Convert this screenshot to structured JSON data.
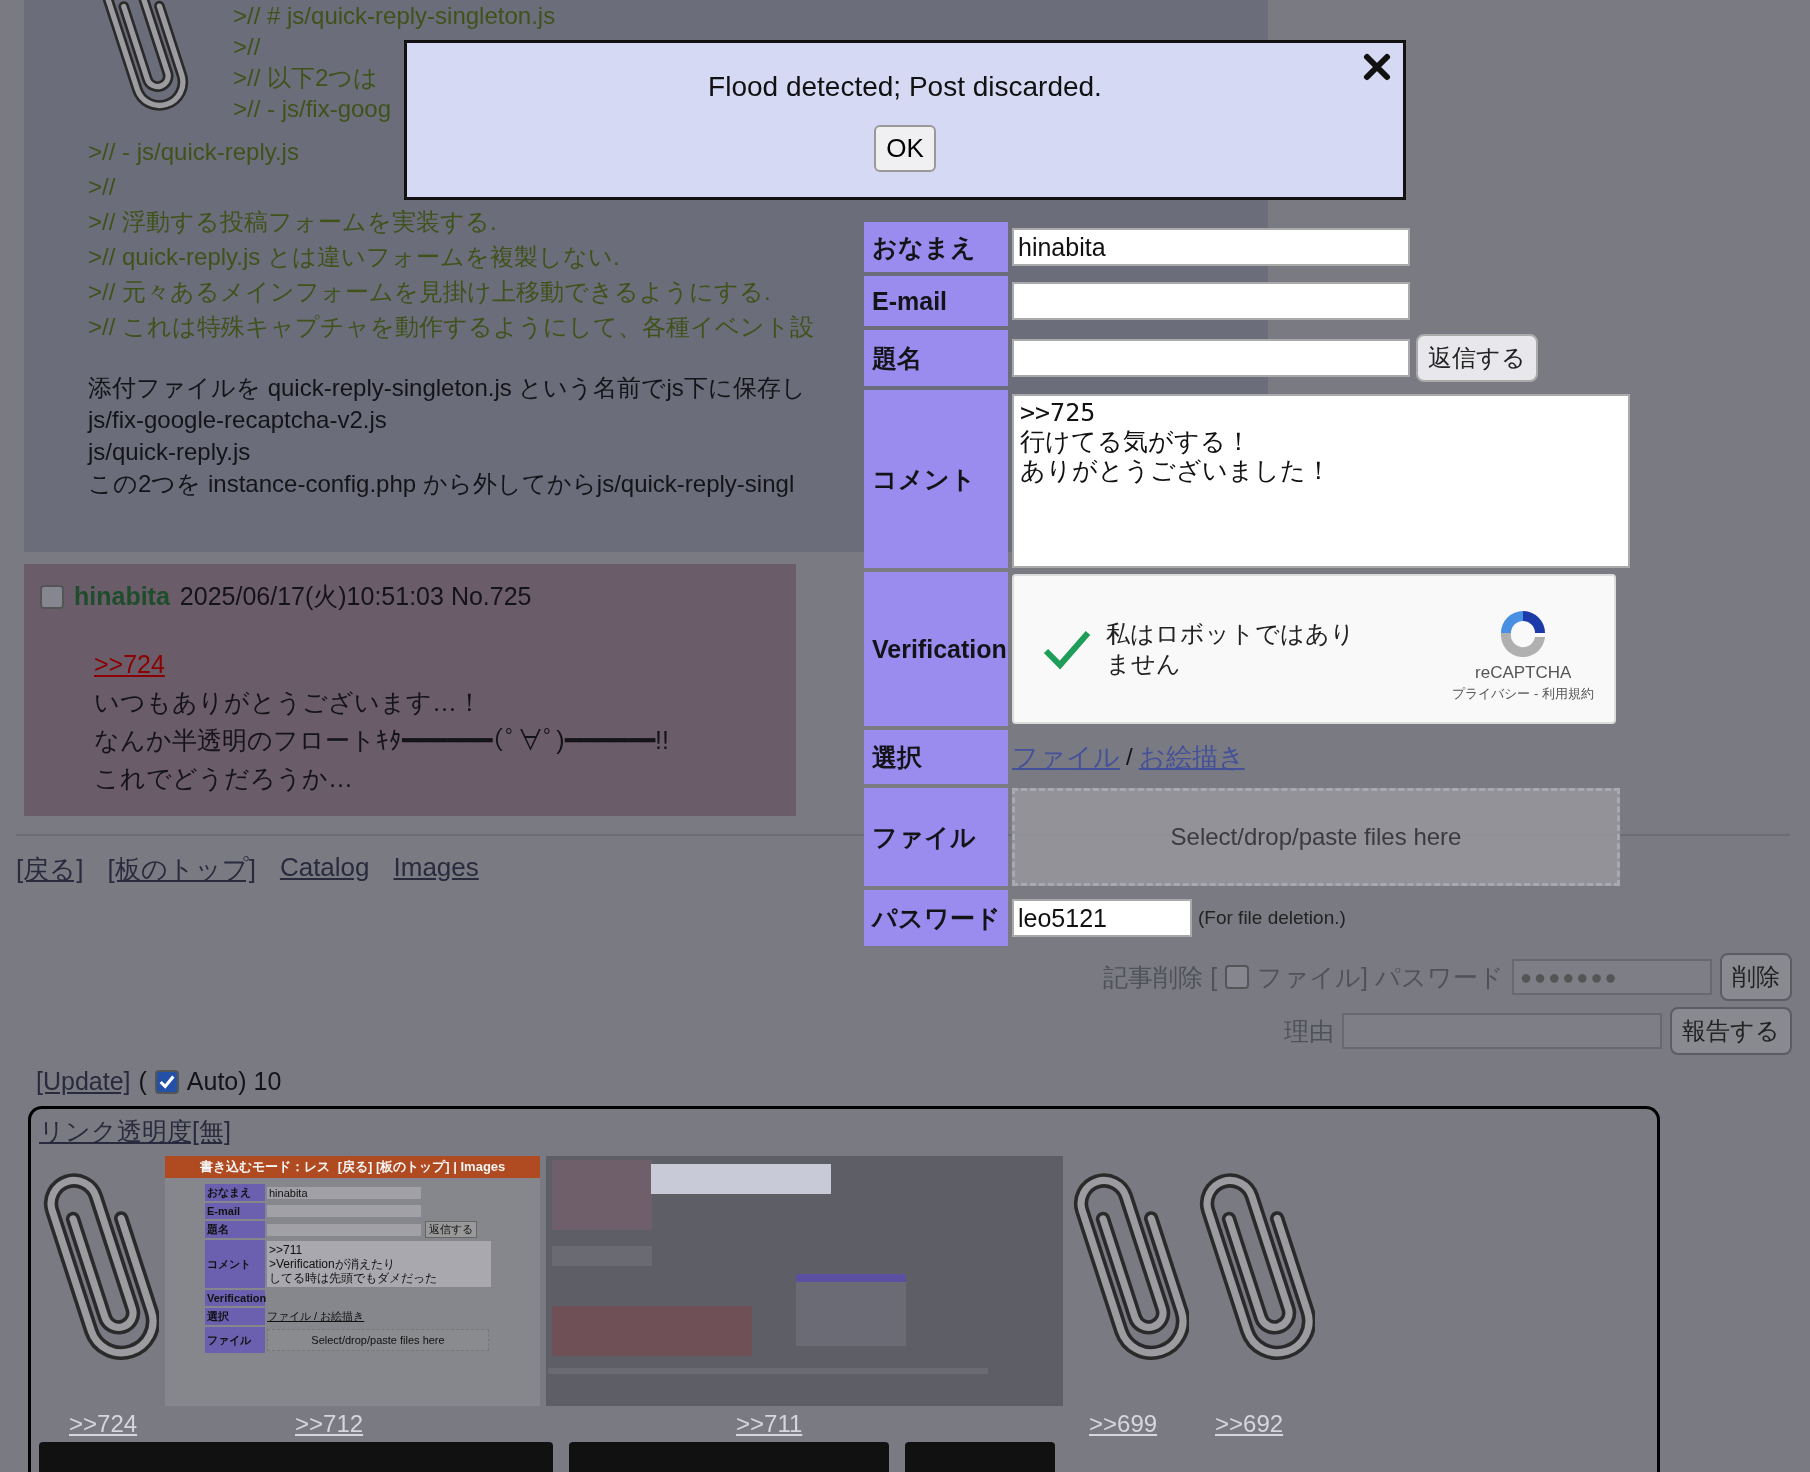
{
  "code_post": {
    "indented_lines": [
      ">// # js/quick-reply-singleton.js",
      ">//",
      ">// 以下2つは",
      ">// - js/fix-goog"
    ],
    "lines": [
      ">// - js/quick-reply.js",
      ">//",
      ">// 浮動する投稿フォームを実装する.",
      ">// quick-reply.js とは違いフォームを複製しない.",
      ">// 元々あるメインフォームを見掛け上移動できるようにする.",
      ">// これは特殊キャプチャを動作するようにして、各種イベント設"
    ],
    "body_lines": [
      "添付ファイルを quick-reply-singleton.js という名前でjs下に保存し",
      "js/fix-google-recaptcha-v2.js",
      "js/quick-reply.js",
      "この2つを instance-config.php から外してからjs/quick-reply-singl"
    ]
  },
  "reply_post": {
    "checked": false,
    "name": "hinabita",
    "date": "2025/06/17(火)10:51:03 No.725",
    "quote": ">>724",
    "lines": [
      "いつもありがとうございます…！",
      "なんか半透明のフロートｷﾀ━━━━━━(ﾟ∀ﾟ)━━━━━━!!",
      "これでどうだろうか…"
    ]
  },
  "nav_links": [
    "[戻る]",
    "[板のトップ]",
    "Catalog",
    "Images"
  ],
  "delete_form": {
    "label": "記事削除 [",
    "file_checked": false,
    "file_label": "ファイル] パスワード",
    "password_value": "●●●●●●●",
    "delete_button": "削除",
    "reason_label": "理由",
    "report_button": "報告する"
  },
  "update": {
    "link": "[Update]",
    "open": "(",
    "auto_checked": true,
    "auto_label": "Auto) 10"
  },
  "gallery": {
    "toggle_link": "リンク透明度[無]",
    "items": [
      {
        "kind": "clip",
        "label": ">>724"
      },
      {
        "kind": "form_shot",
        "label": ">>712"
      },
      {
        "kind": "dark_shot",
        "label": ">>711"
      },
      {
        "kind": "clip",
        "label": ">>699"
      },
      {
        "kind": "clip",
        "label": ">>692"
      }
    ],
    "form_shot": {
      "header": "書き込むモード：レス",
      "header_links": "[戻る] [板のトップ] | Images",
      "rows": [
        {
          "label": "おなまえ",
          "kind": "input",
          "value": "hinabita"
        },
        {
          "label": "E-mail",
          "kind": "input",
          "value": ""
        },
        {
          "label": "題名",
          "kind": "submit",
          "value": "返信する"
        },
        {
          "label": "コメント",
          "kind": "text",
          "lines": [
            ">>711",
            ">Verificationが消えたり",
            "してる時は先頭でもダメだった"
          ]
        },
        {
          "label": "Verification",
          "kind": "empty",
          "value": ""
        },
        {
          "label": "選択",
          "kind": "links",
          "value": "ファイル / お絵描き"
        },
        {
          "label": "ファイル",
          "kind": "drop",
          "value": "Select/drop/paste files here"
        }
      ]
    }
  },
  "form": {
    "rows": [
      {
        "kind": "input",
        "label": "おなまえ",
        "value": "hinabita"
      },
      {
        "kind": "input",
        "label": "E-mail",
        "value": ""
      },
      {
        "kind": "submit",
        "label": "題名",
        "value": "",
        "button": "返信する"
      },
      {
        "kind": "textarea",
        "label": "コメント",
        "lines": [
          ">>725",
          "行けてる気がする！",
          "ありがとうございました！"
        ]
      },
      {
        "kind": "captcha",
        "label": "Verification",
        "checked": true,
        "text": "私はロボットではありません",
        "brand": "reCAPTCHA",
        "terms": "プライバシー - 利用規約"
      },
      {
        "kind": "links",
        "label": "選択",
        "links": [
          "ファイル",
          "お絵描き"
        ],
        "separator": "/"
      },
      {
        "kind": "drop",
        "label": "ファイル",
        "text": "Select/drop/paste files here"
      },
      {
        "kind": "password",
        "label": "パスワード",
        "value": "leo5121",
        "note": "(For file deletion.)"
      }
    ]
  },
  "dialog": {
    "message": "Flood detected; Post discarded.",
    "button": "OK"
  }
}
